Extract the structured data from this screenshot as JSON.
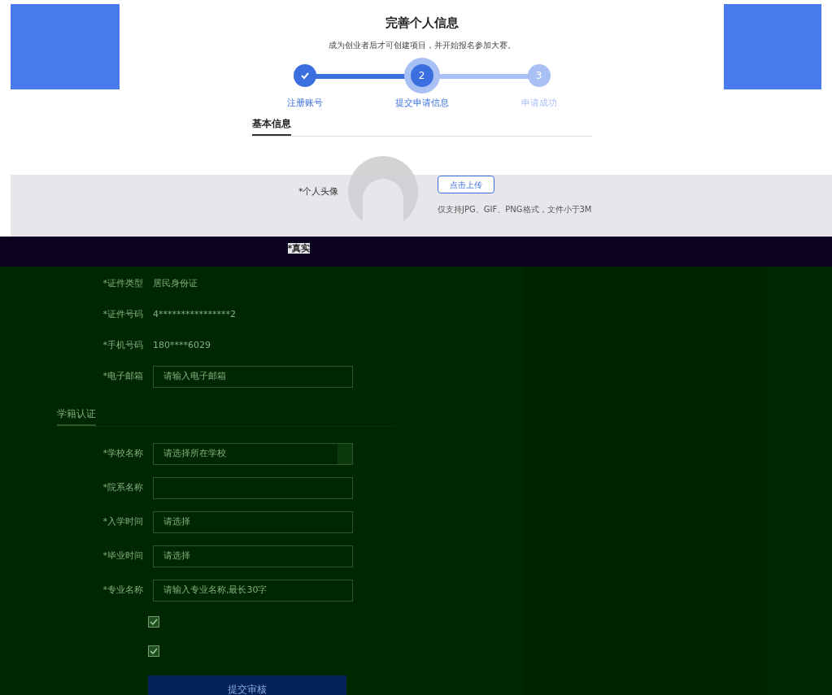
{
  "header": {
    "title": "完善个人信息",
    "subtitle": "成为创业者后才可创建项目，并开始报名参加大赛。"
  },
  "steps": [
    {
      "label": "注册账号",
      "done": true,
      "selected": false
    },
    {
      "label": "提交申请信息",
      "number": "2",
      "done": false,
      "selected": true
    },
    {
      "label": "申请成功",
      "number": "3",
      "done": false,
      "selected": false
    }
  ],
  "basic_section": {
    "title": "基本信息"
  },
  "avatar": {
    "label": "*个人头像",
    "button": "点击上传",
    "hint": "仅支持JPG、GIF、PNG格式，文件小于3M"
  },
  "name_row": {
    "label": "*真实"
  },
  "basic_fields": [
    {
      "label": "*证件类型",
      "value": "居民身份证",
      "kind": "text"
    },
    {
      "label": "*证件号码",
      "value": "4****************2",
      "kind": "text"
    },
    {
      "label": "*手机号码",
      "value": "180****6029",
      "kind": "text"
    },
    {
      "label": "*电子邮箱",
      "placeholder": "请输入电子邮箱",
      "kind": "input"
    }
  ],
  "school_section": {
    "title": "学籍认证"
  },
  "school_fields": [
    {
      "label": "*学校名称",
      "placeholder": "请选择所在学校",
      "kind": "select"
    },
    {
      "label": "*院系名称",
      "kind": "input"
    },
    {
      "label": "*入学时间",
      "placeholder": "请选择",
      "kind": "input"
    },
    {
      "label": "*毕业时间",
      "placeholder": "请选择",
      "kind": "input"
    },
    {
      "label": "*专业名称",
      "placeholder": "请输入专业名称,最长30字",
      "kind": "input"
    }
  ],
  "agreements": [
    {
      "checked": true
    },
    {
      "checked": true
    }
  ],
  "submit": "提交审核"
}
